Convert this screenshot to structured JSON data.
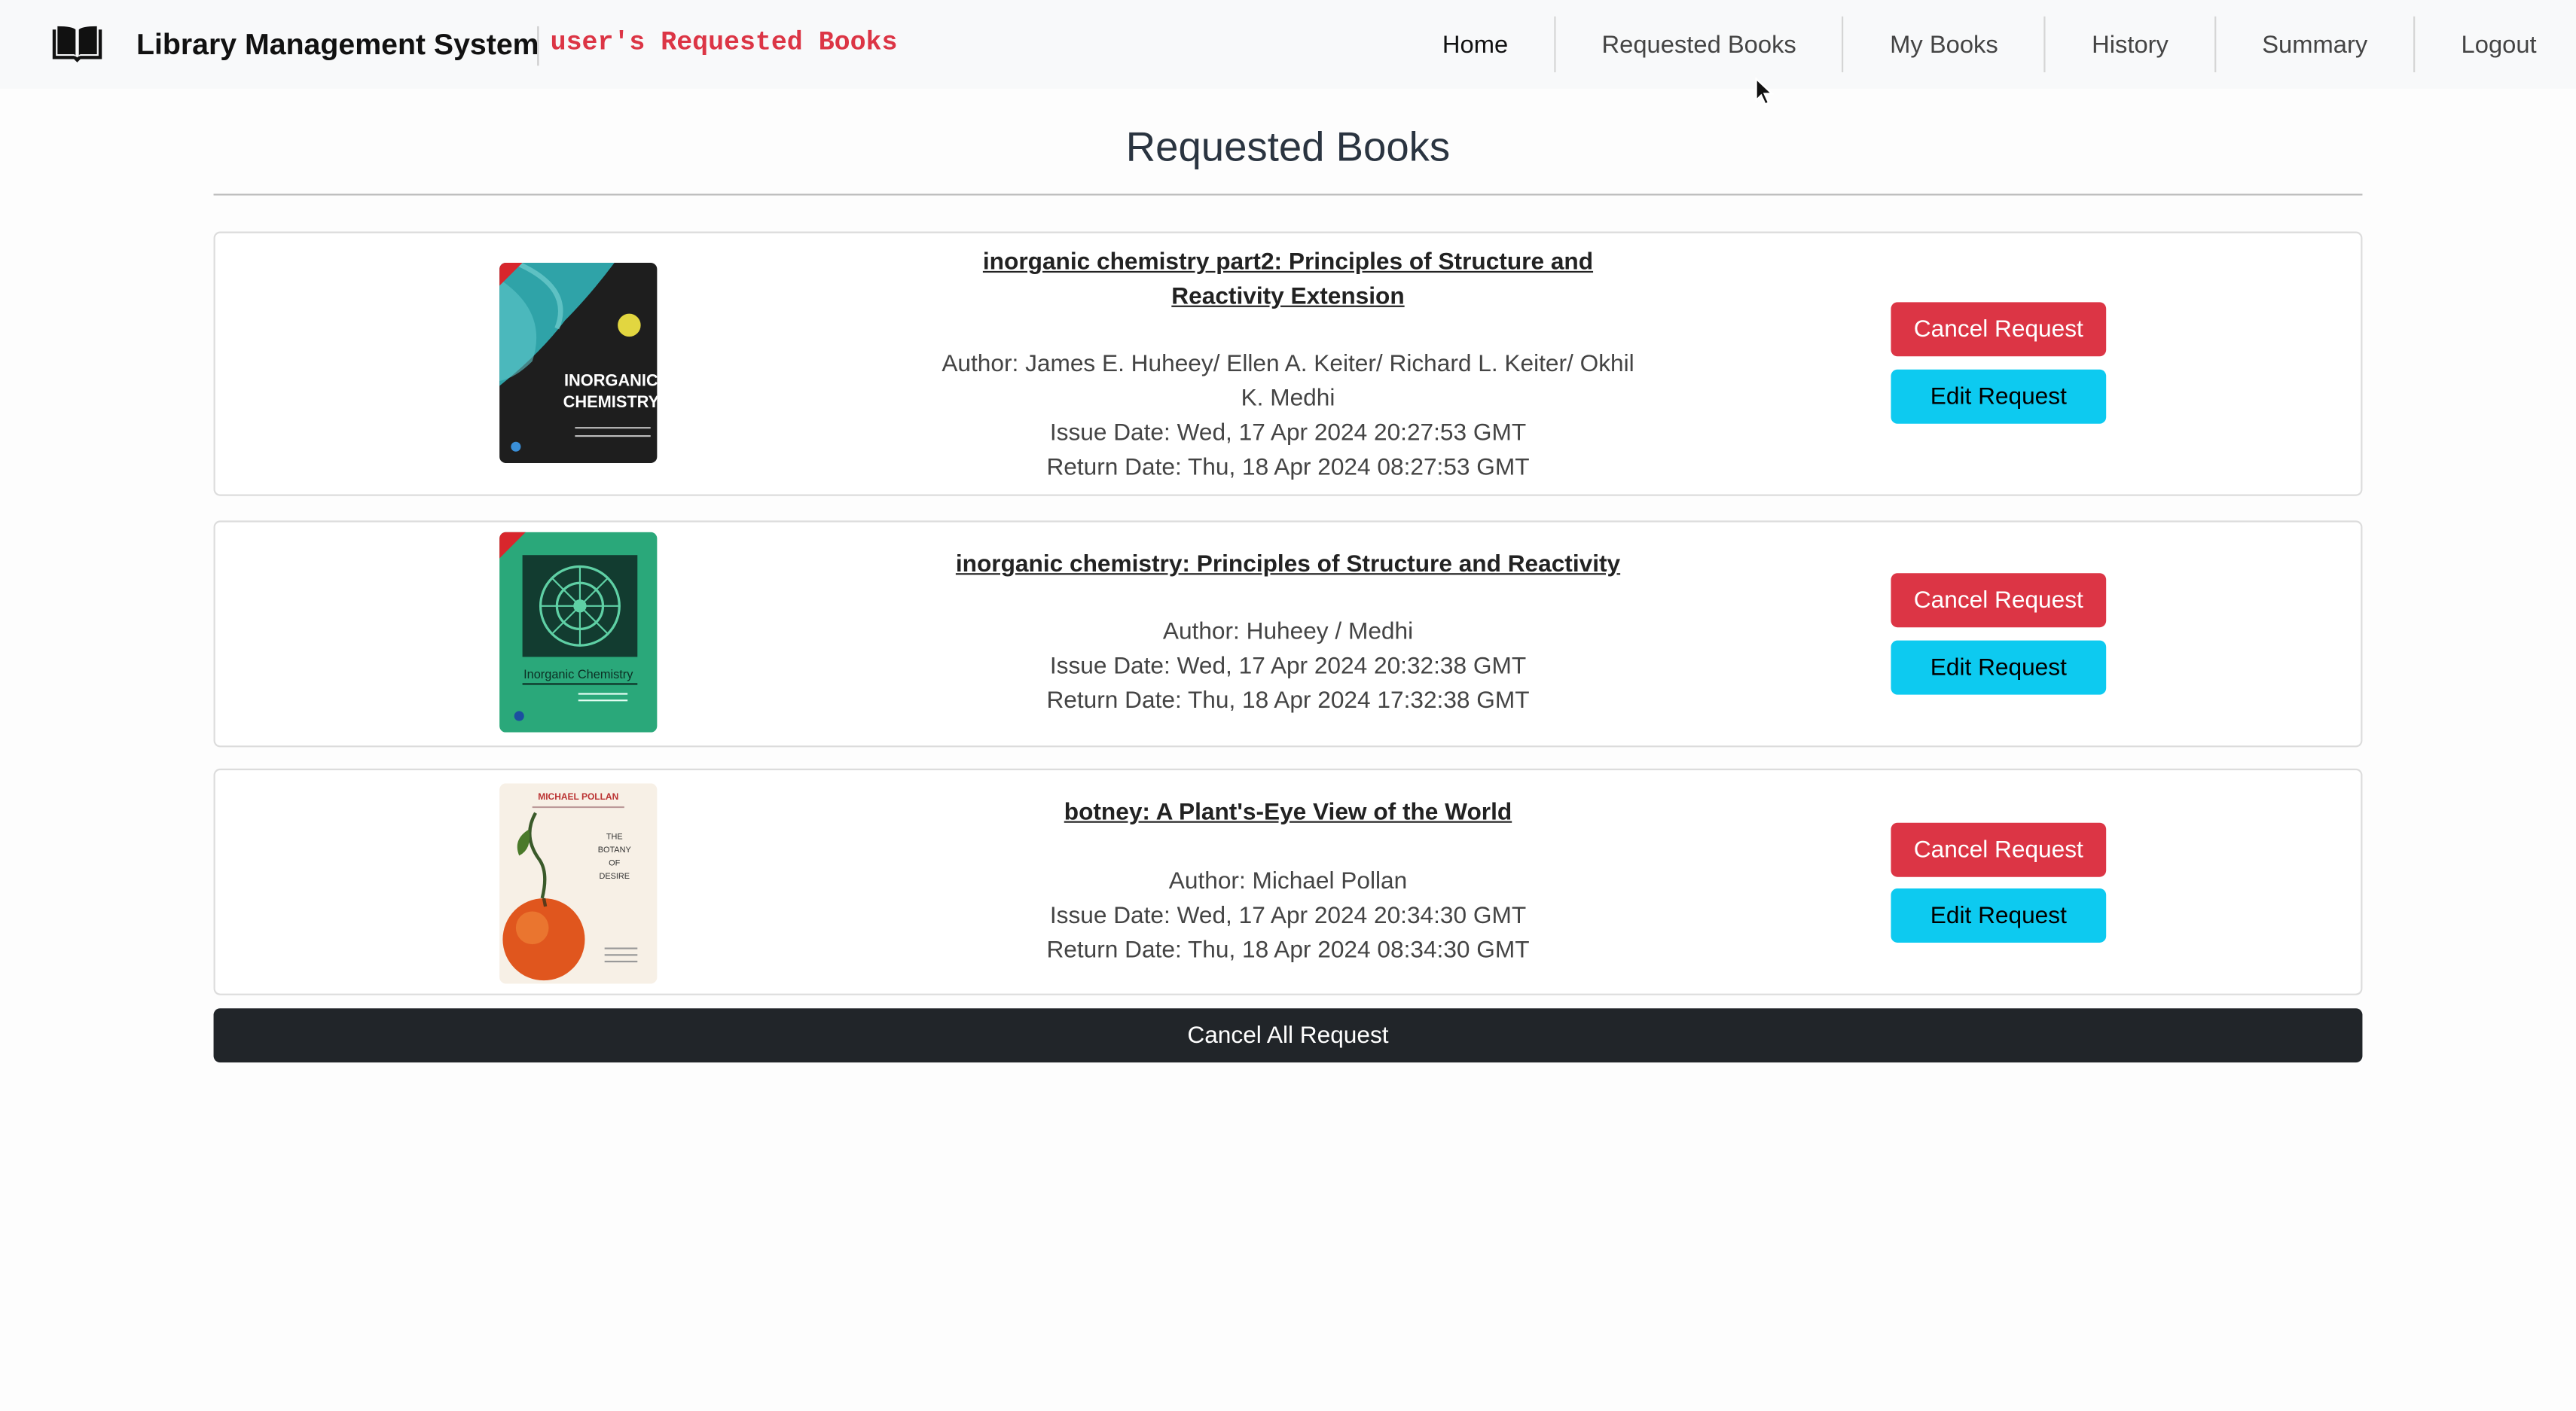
{
  "navbar": {
    "brand_icon": "open-book-icon",
    "brand_name": "Library Management System",
    "subtitle": "user's Requested Books",
    "links": [
      "Home",
      "Requested Books",
      "My Books",
      "History",
      "Summary",
      "Logout"
    ]
  },
  "page": {
    "title": "Requested Books"
  },
  "books": [
    {
      "title_line1": "inorganic chemistry part2: Principles of Structure and",
      "title_line2": "Reactivity Extension",
      "author_line1": "Author: James E. Huheey/ Ellen A. Keiter/ Richard L. Keiter/ Okhil",
      "author_line2": "K. Medhi",
      "issue": "Issue Date: Wed, 17 Apr 2024 20:27:53 GMT",
      "return": "Return Date: Thu, 18 Apr 2024 08:27:53 GMT",
      "cancel_label": "Cancel Request",
      "edit_label": "Edit Request",
      "cover_text_1": "INORGANIC",
      "cover_text_2": "CHEMISTRY"
    },
    {
      "title": "inorganic chemistry: Principles of Structure and Reactivity",
      "author": "Author: Huheey / Medhi",
      "issue": "Issue Date: Wed, 17 Apr 2024 20:32:38 GMT",
      "return": "Return Date: Thu, 18 Apr 2024 17:32:38 GMT",
      "cancel_label": "Cancel Request",
      "edit_label": "Edit Request",
      "cover_text": "Inorganic Chemistry"
    },
    {
      "title": "botney: A Plant's-Eye View of the World",
      "author": "Author: Michael Pollan",
      "issue": "Issue Date: Wed, 17 Apr 2024 20:34:30 GMT",
      "return": "Return Date: Thu, 18 Apr 2024 08:34:30 GMT",
      "cancel_label": "Cancel Request",
      "edit_label": "Edit Request",
      "cover_author": "MICHAEL POLLAN",
      "cover_title_1": "THE",
      "cover_title_2": "BOTANY",
      "cover_title_3": "OF",
      "cover_title_4": "DESIRE"
    }
  ],
  "cancel_all_label": "Cancel All Request",
  "colors": {
    "danger": "#dc3545",
    "info": "#0dcaf0",
    "dark": "#212529"
  }
}
